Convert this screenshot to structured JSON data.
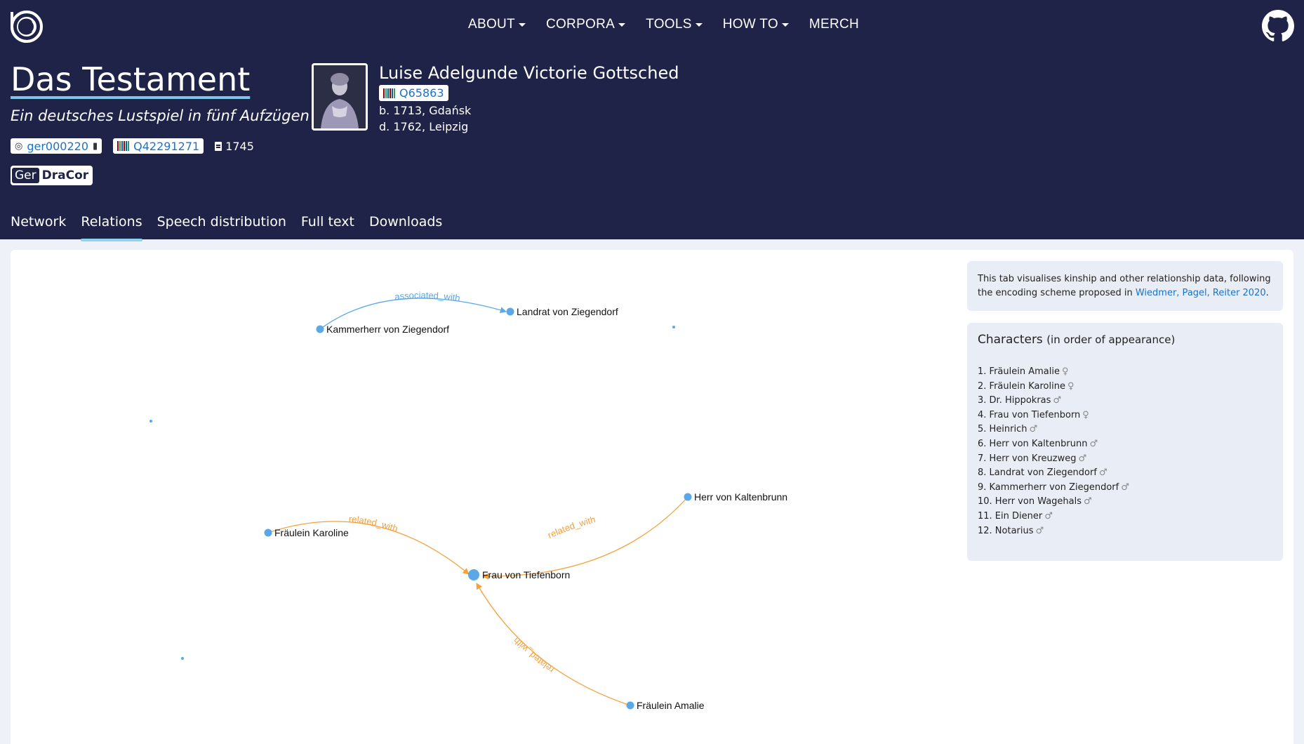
{
  "nav": {
    "items": [
      {
        "label": "ABOUT",
        "dropdown": true
      },
      {
        "label": "CORPORA",
        "dropdown": true
      },
      {
        "label": "TOOLS",
        "dropdown": true
      },
      {
        "label": "HOW TO",
        "dropdown": true
      },
      {
        "label": "MERCH",
        "dropdown": false
      }
    ]
  },
  "play": {
    "title": "Das Testament",
    "subtitle": "Ein deutsches Lustspiel in fünf Aufzügen",
    "id": "ger000220",
    "wikidata": "Q42291271",
    "year": "1745",
    "corpus_prefix": "Ger",
    "corpus_name": "DraCor"
  },
  "author": {
    "name": "Luise Adelgunde Victorie Gottsched",
    "wikidata": "Q65863",
    "born": "b. 1713, Gdańsk",
    "died": "d. 1762, Leipzig"
  },
  "tabs": [
    "Network",
    "Relations",
    "Speech distribution",
    "Full text",
    "Downloads"
  ],
  "active_tab": "Relations",
  "info": {
    "text": "This tab visualises kinship and other relationship data, following the encoding scheme proposed in ",
    "link": "Wiedmer, Pagel, Reiter 2020",
    "suffix": "."
  },
  "characters": {
    "title": "Characters",
    "title_note": "(in order of appearance)",
    "list": [
      {
        "label": "1. Fräulein Amalie",
        "gender": "♀"
      },
      {
        "label": "2. Fräulein Karoline",
        "gender": "♀"
      },
      {
        "label": "3. Dr. Hippokras",
        "gender": "♂"
      },
      {
        "label": "4. Frau von Tiefenborn",
        "gender": "♀"
      },
      {
        "label": "5. Heinrich",
        "gender": "♂"
      },
      {
        "label": "6. Herr von Kaltenbrunn",
        "gender": "♂"
      },
      {
        "label": "7. Herr von Kreuzweg",
        "gender": "♂"
      },
      {
        "label": "8. Landrat von Ziegendorf",
        "gender": "♂"
      },
      {
        "label": "9. Kammerherr von Ziegendorf",
        "gender": "♂"
      },
      {
        "label": "10. Herr von Wagehals",
        "gender": "♂"
      },
      {
        "label": "11. Ein Diener",
        "gender": "♂"
      },
      {
        "label": "12. Notarius",
        "gender": "♂"
      }
    ]
  },
  "graph": {
    "nodes": [
      {
        "id": "kammerherr",
        "label": "Kammerherr von Ziegendorf"
      },
      {
        "id": "landrat",
        "label": "Landrat von Ziegendorf"
      },
      {
        "id": "karoline",
        "label": "Fräulein Karoline"
      },
      {
        "id": "tiefenborn",
        "label": "Frau von Tiefenborn"
      },
      {
        "id": "kaltenbrunn",
        "label": "Herr von Kaltenbrunn"
      },
      {
        "id": "amalie",
        "label": "Fräulein Amalie"
      }
    ],
    "edges": [
      {
        "label": "associated_with",
        "color": "#5aa8e6"
      },
      {
        "label": "related_with",
        "color": "#f5a03c"
      },
      {
        "label": "related_with",
        "color": "#f5a03c"
      },
      {
        "label": "related_with",
        "color": "#f5a03c"
      }
    ]
  },
  "colors": {
    "header_bg": "#1f2347",
    "accent": "#8fd3f0",
    "link": "#1a73c8",
    "node": "#5aa8e6",
    "kin_edge": "#f5a03c"
  }
}
